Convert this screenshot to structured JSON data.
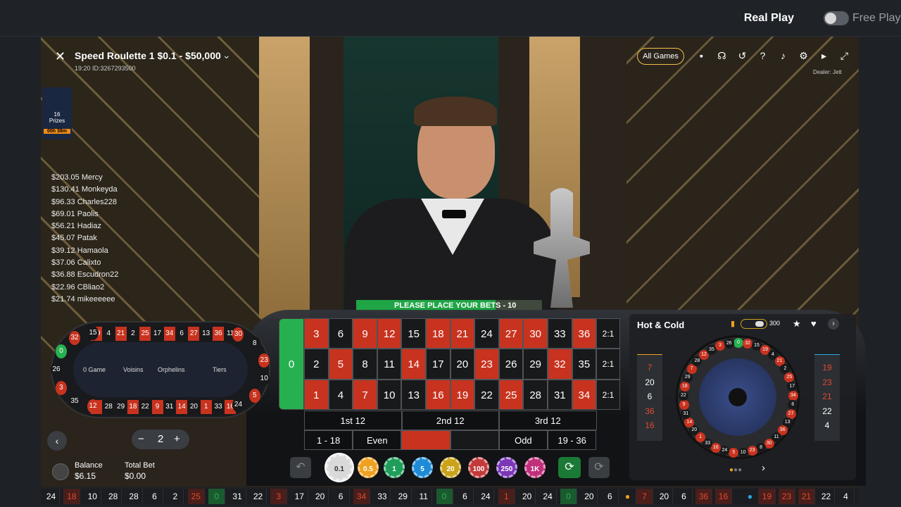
{
  "header": {
    "real_play": "Real Play",
    "free_play": "Free Play"
  },
  "game": {
    "title": "Speed Roulette 1 $0.1 - $50,000",
    "time": "19:20",
    "id": "ID:3267293500",
    "dealer": "Dealer: Jett",
    "close": "✕",
    "chevron": "⌄"
  },
  "promo": {
    "title": "16",
    "sub": "Prizes",
    "timer": "00h 38m"
  },
  "top_bar": {
    "all_games": "All Games",
    "icons": [
      "chat-icon",
      "headset-icon",
      "history-icon",
      "help-icon",
      "volume-icon",
      "settings-icon",
      "video-icon",
      "fullscreen-icon"
    ]
  },
  "winners": [
    "$203.05 Mercy",
    "$130.41 Monkeyda",
    "$96.33 Charles228",
    "$69.01 Paolis",
    "$56.21 Hadiaz",
    "$45.07 Patak",
    "$39.12 Hamaola",
    "$37.06 Calixto",
    "$36.88 Escudron22",
    "$22.96 CBliao2",
    "$21.74 mikeeeeee"
  ],
  "status": {
    "message": "PLEASE PLACE YOUR BETS",
    "countdown": "10",
    "progress": 0.75
  },
  "board": {
    "zero": "0",
    "rows": [
      [
        [
          "3",
          "r"
        ],
        [
          "6",
          "b"
        ],
        [
          "9",
          "r"
        ],
        [
          "12",
          "r"
        ],
        [
          "15",
          "b"
        ],
        [
          "18",
          "r"
        ],
        [
          "21",
          "r"
        ],
        [
          "24",
          "b"
        ],
        [
          "27",
          "r"
        ],
        [
          "30",
          "r"
        ],
        [
          "33",
          "b"
        ],
        [
          "36",
          "r"
        ]
      ],
      [
        [
          "2",
          "b"
        ],
        [
          "5",
          "r"
        ],
        [
          "8",
          "b"
        ],
        [
          "11",
          "b"
        ],
        [
          "14",
          "r"
        ],
        [
          "17",
          "b"
        ],
        [
          "20",
          "b"
        ],
        [
          "23",
          "r"
        ],
        [
          "26",
          "b"
        ],
        [
          "29",
          "b"
        ],
        [
          "32",
          "r"
        ],
        [
          "35",
          "b"
        ]
      ],
      [
        [
          "1",
          "r"
        ],
        [
          "4",
          "b"
        ],
        [
          "7",
          "r"
        ],
        [
          "10",
          "b"
        ],
        [
          "13",
          "b"
        ],
        [
          "16",
          "r"
        ],
        [
          "19",
          "r"
        ],
        [
          "22",
          "b"
        ],
        [
          "25",
          "r"
        ],
        [
          "28",
          "b"
        ],
        [
          "31",
          "b"
        ],
        [
          "34",
          "r"
        ]
      ]
    ],
    "column_bets": [
      "2:1",
      "2:1",
      "2:1"
    ],
    "dozens": [
      "1st 12",
      "2nd 12",
      "3rd 12"
    ],
    "outside": [
      "1 - 18",
      "Even",
      "",
      "",
      "Odd",
      "19 - 36"
    ]
  },
  "racetrack": {
    "sections": [
      "0 Game",
      "Voisins",
      "Orphelins",
      "Tiers"
    ],
    "top": [
      [
        "19",
        "r"
      ],
      [
        "4",
        "b"
      ],
      [
        "21",
        "r"
      ],
      [
        "2",
        "b"
      ],
      [
        "25",
        "r"
      ],
      [
        "17",
        "b"
      ],
      [
        "34",
        "r"
      ],
      [
        "6",
        "b"
      ],
      [
        "27",
        "r"
      ],
      [
        "13",
        "b"
      ],
      [
        "36",
        "r"
      ],
      [
        "11",
        "b"
      ]
    ],
    "bottom": [
      [
        "7",
        "r"
      ],
      [
        "28",
        "b"
      ],
      [
        "29",
        "b"
      ],
      [
        "18",
        "r"
      ],
      [
        "22",
        "b"
      ],
      [
        "9",
        "r"
      ],
      [
        "31",
        "b"
      ],
      [
        "14",
        "r"
      ],
      [
        "20",
        "b"
      ],
      [
        "1",
        "r"
      ],
      [
        "33",
        "b"
      ],
      [
        "16",
        "r"
      ]
    ],
    "left": [
      [
        "15",
        "b"
      ],
      [
        "32",
        "r"
      ],
      [
        "0",
        "g"
      ],
      [
        "26",
        "b"
      ],
      [
        "3",
        "r"
      ],
      [
        "35",
        "b"
      ],
      [
        "12",
        "r"
      ]
    ],
    "right": [
      [
        "30",
        "r"
      ],
      [
        "8",
        "b"
      ],
      [
        "23",
        "r"
      ],
      [
        "10",
        "b"
      ],
      [
        "5",
        "r"
      ],
      [
        "24",
        "b"
      ]
    ]
  },
  "controls": {
    "stepper_value": "2",
    "minus": "−",
    "plus": "+",
    "balance_label": "Balance",
    "balance": "$6.15",
    "total_bet_label": "Total Bet",
    "total_bet": "$0.00"
  },
  "chips": [
    {
      "v": "0.1",
      "c": "#d9d9d9"
    },
    {
      "v": "0.5",
      "c": "#f0a020"
    },
    {
      "v": "1",
      "c": "#1e9e5a"
    },
    {
      "v": "5",
      "c": "#1d8bd8"
    },
    {
      "v": "20",
      "c": "#c9a21a"
    },
    {
      "v": "100",
      "c": "#c23a3a"
    },
    {
      "v": "250",
      "c": "#7b36b8"
    },
    {
      "v": "1K",
      "c": "#c02f7a"
    }
  ],
  "hot_cold": {
    "title": "Hot & Cold",
    "count": "300",
    "hot": [
      [
        "7",
        "r"
      ],
      [
        "20",
        "w"
      ],
      [
        "6",
        "w"
      ],
      [
        "36",
        "r"
      ],
      [
        "16",
        "r"
      ]
    ],
    "cold": [
      [
        "19",
        "r"
      ],
      [
        "23",
        "r"
      ],
      [
        "21",
        "r"
      ],
      [
        "22",
        "w"
      ],
      [
        "4",
        "w"
      ]
    ]
  },
  "wheel": [
    [
      "0",
      "g"
    ],
    [
      "32",
      "r"
    ],
    [
      "15",
      "b"
    ],
    [
      "19",
      "r"
    ],
    [
      "4",
      "b"
    ],
    [
      "21",
      "r"
    ],
    [
      "2",
      "b"
    ],
    [
      "25",
      "r"
    ],
    [
      "17",
      "b"
    ],
    [
      "34",
      "r"
    ],
    [
      "6",
      "b"
    ],
    [
      "27",
      "r"
    ],
    [
      "13",
      "b"
    ],
    [
      "36",
      "r"
    ],
    [
      "11",
      "b"
    ],
    [
      "30",
      "r"
    ],
    [
      "8",
      "b"
    ],
    [
      "23",
      "r"
    ],
    [
      "10",
      "b"
    ],
    [
      "5",
      "r"
    ],
    [
      "24",
      "b"
    ],
    [
      "16",
      "r"
    ],
    [
      "33",
      "b"
    ],
    [
      "1",
      "r"
    ],
    [
      "20",
      "b"
    ],
    [
      "14",
      "r"
    ],
    [
      "31",
      "b"
    ],
    [
      "9",
      "r"
    ],
    [
      "22",
      "b"
    ],
    [
      "18",
      "r"
    ],
    [
      "29",
      "b"
    ],
    [
      "7",
      "r"
    ],
    [
      "28",
      "b"
    ],
    [
      "12",
      "r"
    ],
    [
      "35",
      "b"
    ],
    [
      "3",
      "r"
    ],
    [
      "26",
      "b"
    ]
  ],
  "history": [
    [
      "24",
      "w"
    ],
    [
      "18",
      "r"
    ],
    [
      "10",
      "w"
    ],
    [
      "28",
      "w"
    ],
    [
      "28",
      "w"
    ],
    [
      "6",
      "w"
    ],
    [
      "2",
      "w"
    ],
    [
      "25",
      "r"
    ],
    [
      "0",
      "g"
    ],
    [
      "31",
      "w"
    ],
    [
      "22",
      "w"
    ],
    [
      "3",
      "r"
    ],
    [
      "17",
      "w"
    ],
    [
      "20",
      "w"
    ],
    [
      "6",
      "w"
    ],
    [
      "34",
      "r"
    ],
    [
      "33",
      "w"
    ],
    [
      "29",
      "w"
    ],
    [
      "11",
      "w"
    ],
    [
      "0",
      "g"
    ],
    [
      "6",
      "w"
    ],
    [
      "24",
      "w"
    ],
    [
      "1",
      "r"
    ],
    [
      "20",
      "w"
    ],
    [
      "24",
      "w"
    ],
    [
      "0",
      "g"
    ],
    [
      "20",
      "w"
    ],
    [
      "6",
      "w"
    ]
  ],
  "history_hot": [
    [
      "7",
      "r"
    ],
    [
      "20",
      "w"
    ],
    [
      "6",
      "w"
    ],
    [
      "36",
      "r"
    ],
    [
      "16",
      "r"
    ]
  ],
  "history_cold": [
    [
      "19",
      "r"
    ],
    [
      "23",
      "r"
    ],
    [
      "21",
      "r"
    ],
    [
      "22",
      "w"
    ],
    [
      "4",
      "w"
    ]
  ]
}
